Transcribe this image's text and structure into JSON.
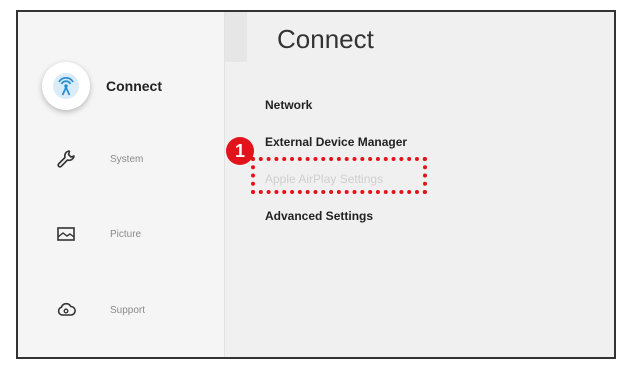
{
  "sidebar": {
    "items": [
      {
        "label": "Connect",
        "icon": "connect-icon",
        "active": true
      },
      {
        "label": "System",
        "icon": "wrench-icon"
      },
      {
        "label": "Picture",
        "icon": "picture-icon"
      },
      {
        "label": "Support",
        "icon": "cloud-support-icon"
      }
    ]
  },
  "main": {
    "title": "Connect",
    "menu": [
      {
        "label": "Network"
      },
      {
        "label": "External Device Manager"
      },
      {
        "label": "Apple AirPlay Settings",
        "disabled": true
      },
      {
        "label": "Advanced Settings"
      }
    ]
  },
  "annotation": {
    "badge": "1",
    "color": "#e3131b"
  }
}
